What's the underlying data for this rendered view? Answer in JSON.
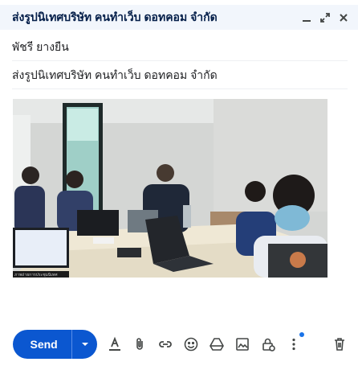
{
  "window": {
    "title": "ส่งรูปนิเทศบริษัท คนทำเว็บ ดอทคอม จำกัด",
    "controls": [
      "minimize-icon",
      "expand-icon",
      "close-icon"
    ]
  },
  "compose": {
    "recipient": "พัชรี ยางยืน",
    "subject": "ส่งรูปนิเทศบริษัท คนทำเว็บ ดอทคอม จำกัด"
  },
  "attachment": {
    "caption": "ภาพถ่ายการประชุมนิเทศ"
  },
  "toolbar": {
    "send_label": "Send",
    "tools": [
      "text-format-icon",
      "attach-icon",
      "link-icon",
      "emoji-icon",
      "drive-icon",
      "image-icon",
      "confidential-lock-icon",
      "more-options-icon",
      "delete-icon"
    ]
  },
  "colors": {
    "accent": "#0b57d0",
    "titlebar": "#f2f6fc",
    "title_text": "#041e49",
    "notification_dot": "#1a73e8"
  }
}
